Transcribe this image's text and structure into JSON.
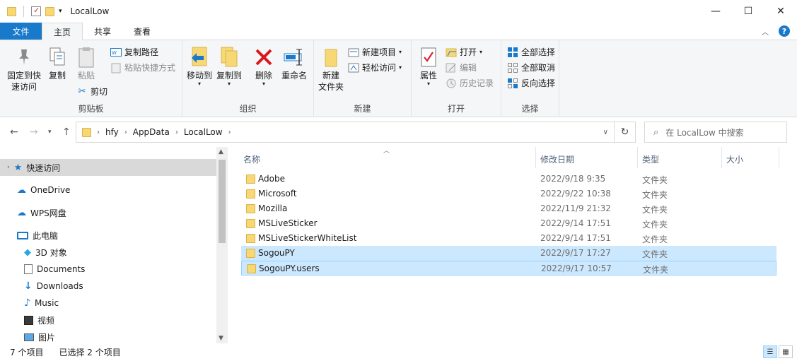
{
  "window": {
    "title": "LocalLow",
    "controls": {
      "minimize": "—",
      "maximize": "☐",
      "close": "✕"
    }
  },
  "ribbon_tabs": [
    "文件",
    "主页",
    "共享",
    "查看"
  ],
  "ribbon": {
    "clipboard": {
      "label": "剪贴板",
      "pin": "固定到快\n速访问",
      "copy": "复制",
      "paste": "粘贴",
      "copy_path": "复制路径",
      "paste_shortcut": "粘贴快捷方式",
      "cut": "剪切"
    },
    "organize": {
      "label": "组织",
      "move_to": "移动到",
      "copy_to": "复制到",
      "delete": "删除",
      "rename": "重命名"
    },
    "new": {
      "label": "新建",
      "new_folder": "新建\n文件夹",
      "new_item": "新建项目",
      "easy_access": "轻松访问"
    },
    "open": {
      "label": "打开",
      "properties": "属性",
      "open": "打开",
      "edit": "编辑",
      "history": "历史记录"
    },
    "select": {
      "label": "选择",
      "select_all": "全部选择",
      "select_none": "全部取消",
      "invert": "反向选择"
    }
  },
  "address": {
    "crumbs": [
      "hfy",
      "AppData",
      "LocalLow"
    ],
    "search_placeholder": "在 LocalLow 中搜索"
  },
  "nav": {
    "quick_access": "快速访问",
    "onedrive": "OneDrive",
    "wps": "WPS网盘",
    "this_pc": "此电脑",
    "items": [
      "3D 对象",
      "Documents",
      "Downloads",
      "Music",
      "视频",
      "图片"
    ]
  },
  "columns": {
    "name": "名称",
    "date": "修改日期",
    "type": "类型",
    "size": "大小"
  },
  "files": [
    {
      "name": "Adobe",
      "date": "2022/9/18 9:35",
      "type": "文件夹"
    },
    {
      "name": "Microsoft",
      "date": "2022/9/22 10:38",
      "type": "文件夹"
    },
    {
      "name": "Mozilla",
      "date": "2022/11/9 21:32",
      "type": "文件夹"
    },
    {
      "name": "MSLiveSticker",
      "date": "2022/9/14 17:51",
      "type": "文件夹"
    },
    {
      "name": "MSLiveStickerWhiteList",
      "date": "2022/9/14 17:51",
      "type": "文件夹"
    },
    {
      "name": "SogouPY",
      "date": "2022/9/17 17:27",
      "type": "文件夹"
    },
    {
      "name": "SogouPY.users",
      "date": "2022/9/17 10:57",
      "type": "文件夹"
    }
  ],
  "status": {
    "count": "7 个项目",
    "selected": "已选择 2 个项目"
  }
}
